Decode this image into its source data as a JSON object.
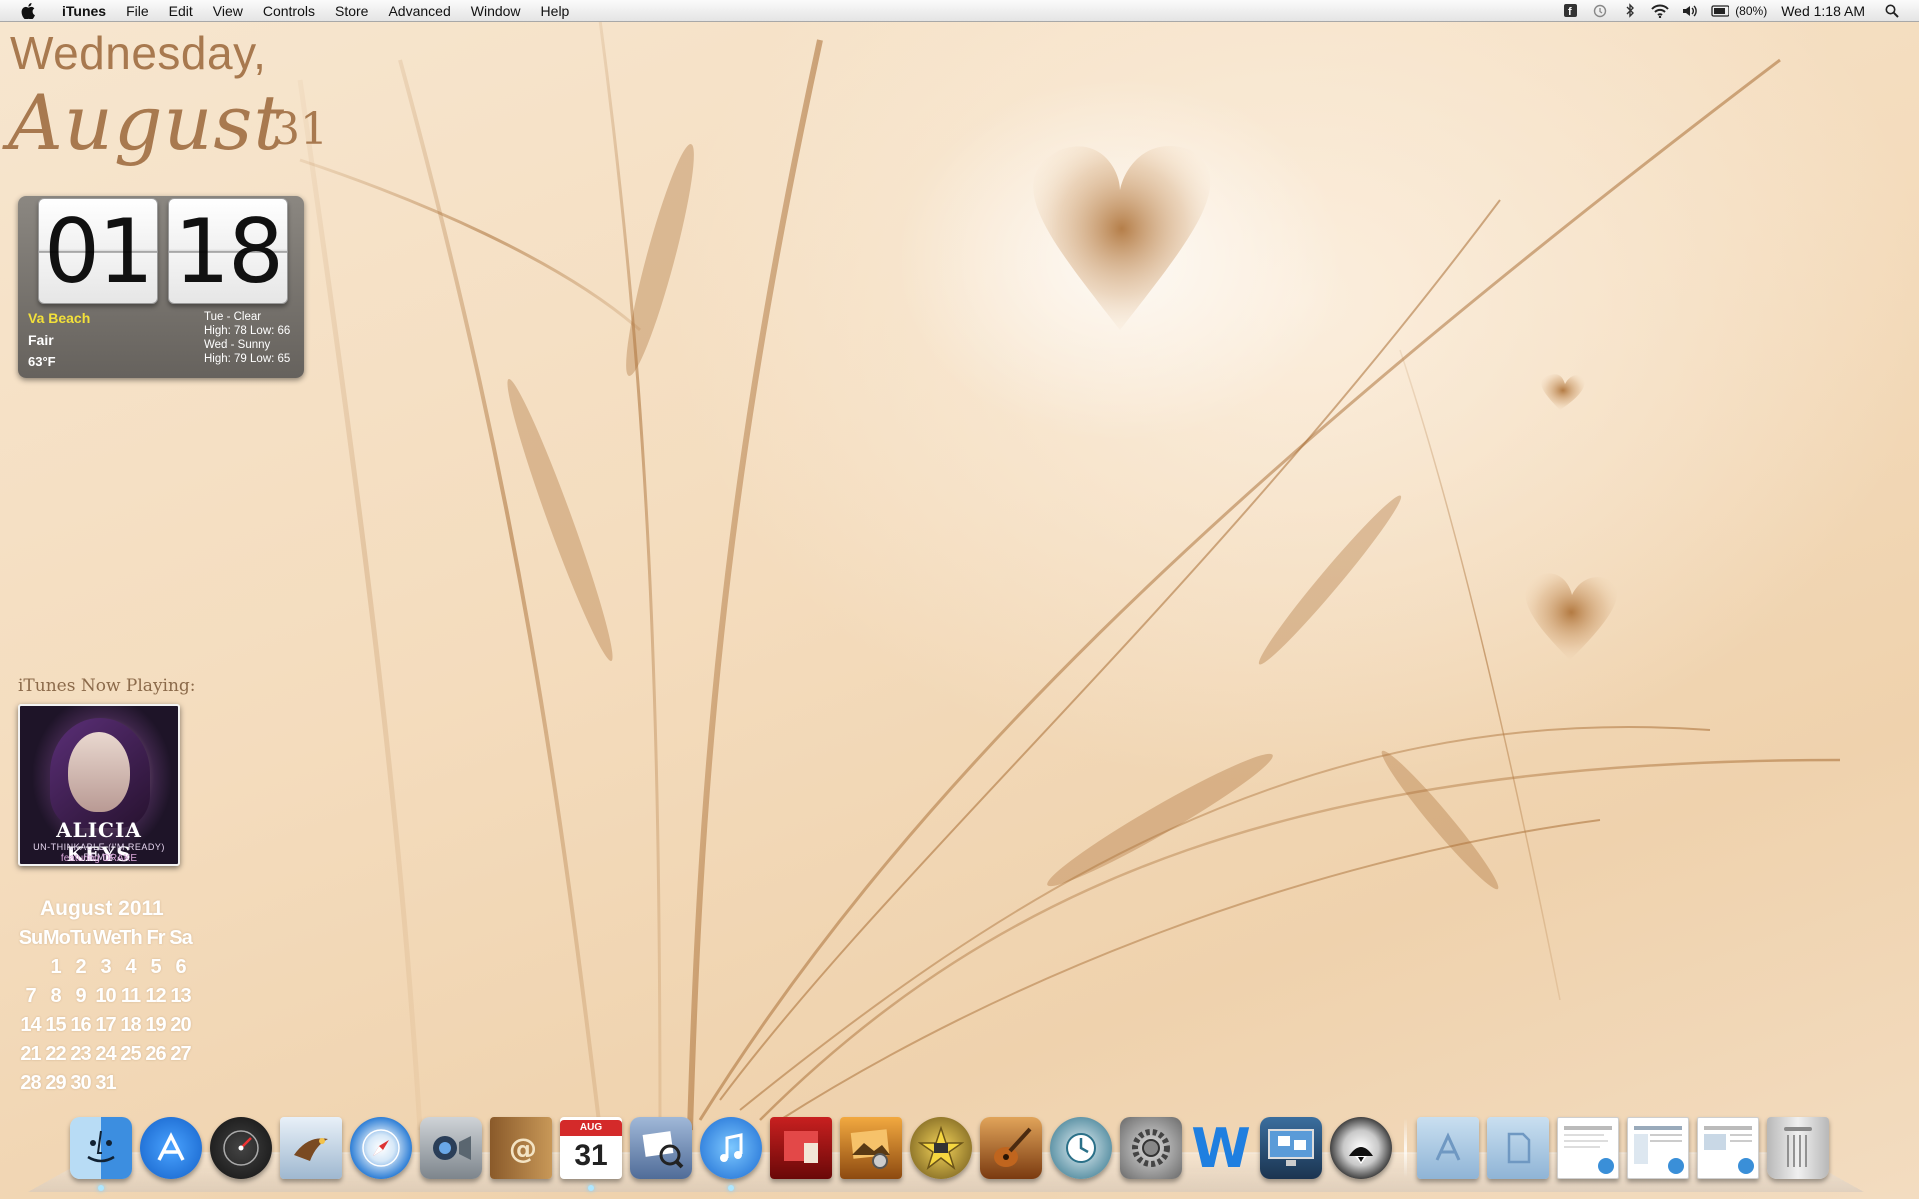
{
  "menubar": {
    "app_name": "iTunes",
    "menus": [
      "File",
      "Edit",
      "View",
      "Controls",
      "Store",
      "Advanced",
      "Window",
      "Help"
    ],
    "battery": "(80%)",
    "clock": "Wed 1:18 AM",
    "status_icons": [
      "facebook-icon",
      "time-machine-icon",
      "bluetooth-icon",
      "wifi-icon",
      "volume-icon",
      "battery-icon",
      "spotlight-icon"
    ]
  },
  "date_widget": {
    "weekday": "Wednesday,",
    "month": "August",
    "day": "31"
  },
  "weather_clock": {
    "hours": "01",
    "minutes": "18",
    "city": "Va Beach",
    "condition": "Fair",
    "temp": "63°F",
    "forecast": [
      "Tue - Clear",
      "High: 78 Low: 66",
      "Wed - Sunny",
      "High: 79 Low: 65"
    ]
  },
  "now_playing": {
    "label": "iTunes Now Playing:",
    "artist": "ALICIA KEYS",
    "title": "UN-THINKABLE (I'M READY) REMIX",
    "featuring": "featuring DRAKE"
  },
  "calendar": {
    "title": "August 2011",
    "weekdays": [
      "Su",
      "Mo",
      "Tu",
      "We",
      "Th",
      "Fr",
      "Sa"
    ],
    "weeks": [
      [
        "",
        "1",
        "2",
        "3",
        "4",
        "5",
        "6"
      ],
      [
        "7",
        "8",
        "9",
        "10",
        "11",
        "12",
        "13"
      ],
      [
        "14",
        "15",
        "16",
        "17",
        "18",
        "19",
        "20"
      ],
      [
        "21",
        "22",
        "23",
        "24",
        "25",
        "26",
        "27"
      ],
      [
        "28",
        "29",
        "30",
        "31",
        "",
        "",
        ""
      ]
    ]
  },
  "dock": {
    "ical_month": "AUG",
    "ical_day": "31",
    "word_letter": "W",
    "apps": [
      "finder",
      "app-store",
      "dashboard",
      "mail",
      "safari",
      "facetime",
      "address-book",
      "ical",
      "preview",
      "itunes",
      "front-row",
      "iphoto",
      "imovie",
      "garageband",
      "time-machine",
      "system-preferences",
      "word",
      "screen-sharing",
      "dvd-player"
    ],
    "stacks": [
      "applications-folder",
      "documents-folder",
      "window-thumb-1",
      "window-thumb-2",
      "window-thumb-3",
      "trash"
    ]
  }
}
